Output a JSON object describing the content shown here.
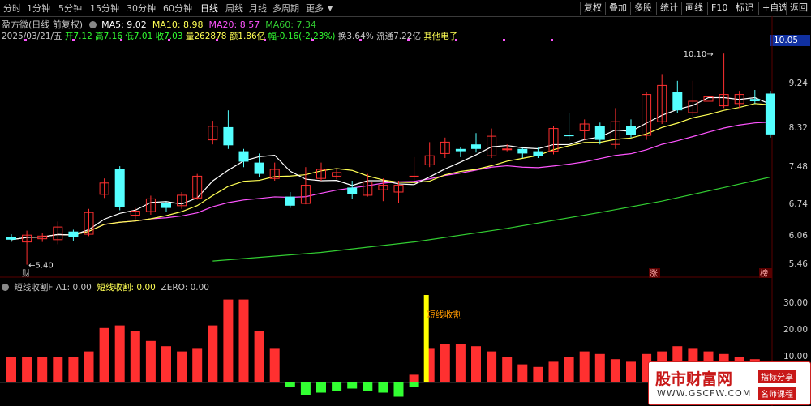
{
  "toolbar": {
    "periods": [
      "分时",
      "1分钟",
      "5分钟",
      "15分钟",
      "30分钟",
      "60分钟",
      "日线",
      "周线",
      "月线",
      "多周期",
      "更多"
    ],
    "active_period": "日线",
    "right_buttons": [
      "复权",
      "叠加",
      "多股",
      "统计",
      "画线",
      "F10",
      "标记",
      "+自选",
      "返回"
    ]
  },
  "header": {
    "stock_title": "盈方微(日线 前复权)",
    "ma_labels": {
      "ma5": "MA5: 9.02",
      "ma10": "MA10: 8.98",
      "ma20": "MA20: 8.57",
      "ma60": "MA60: 7.34"
    },
    "date": "2025/03/21/五",
    "open": "开7.12",
    "high": "高7.16",
    "low": "低7.01",
    "close": "收7.03",
    "volume": "量262878",
    "amount": "额1.86亿",
    "change": "幅-0.16(-2.23%)",
    "turnover": "换3.64%",
    "float": "流通7.22亿",
    "sector": "其他电子"
  },
  "indicator": {
    "name": "短线收割F",
    "a1": "A1: 0.00",
    "main": "短线收割: 0.00",
    "zero": "ZERO: 0.00",
    "signal_label": "短线收割"
  },
  "price_axis": [
    "9.24",
    "8.32",
    "7.48",
    "6.74",
    "6.06",
    "5.46"
  ],
  "current_price_box": "10.05",
  "indicator_axis": [
    "30.00",
    "20.00",
    "10.00"
  ],
  "annotations": {
    "high_label": "10.10",
    "low_label": "5.40",
    "marker_cai": "财",
    "marker_zhang": "涨",
    "marker_bang": "榜"
  },
  "watermark": {
    "site": "股市财富网",
    "url": "WWW.GSCFW.COM",
    "tag1": "指标分享",
    "tag2": "名师课程"
  },
  "colors": {
    "up": "#ff3030",
    "down": "#54ffff",
    "ma5": "#ffffff",
    "ma10": "#ffff54",
    "ma20": "#ff54ff",
    "ma60": "#32cd32",
    "signal": "#ffff00",
    "neg_bar": "#32ff32"
  },
  "chart_data": {
    "type": "candlestick",
    "ylim": [
      5.3,
      10.3
    ],
    "candles": [
      {
        "o": 6.06,
        "c": 6.0,
        "h": 6.12,
        "l": 5.95
      },
      {
        "o": 5.95,
        "c": 6.1,
        "h": 6.2,
        "l": 5.45
      },
      {
        "o": 6.02,
        "c": 6.08,
        "h": 6.15,
        "l": 5.95
      },
      {
        "o": 6.0,
        "c": 6.28,
        "h": 6.4,
        "l": 5.9
      },
      {
        "o": 6.18,
        "c": 6.05,
        "h": 6.22,
        "l": 5.98
      },
      {
        "o": 6.12,
        "c": 6.6,
        "h": 6.68,
        "l": 6.08
      },
      {
        "o": 7.0,
        "c": 7.25,
        "h": 7.35,
        "l": 6.92
      },
      {
        "o": 7.55,
        "c": 6.72,
        "h": 7.62,
        "l": 6.65
      },
      {
        "o": 6.54,
        "c": 6.63,
        "h": 6.7,
        "l": 6.45
      },
      {
        "o": 6.62,
        "c": 6.9,
        "h": 6.97,
        "l": 6.55
      },
      {
        "o": 6.8,
        "c": 6.7,
        "h": 6.83,
        "l": 6.62
      },
      {
        "o": 6.75,
        "c": 6.98,
        "h": 7.05,
        "l": 6.68
      },
      {
        "o": 6.92,
        "c": 7.4,
        "h": 7.45,
        "l": 6.88
      },
      {
        "o": 8.2,
        "c": 8.5,
        "h": 8.62,
        "l": 8.1
      },
      {
        "o": 8.48,
        "c": 8.08,
        "h": 8.85,
        "l": 8.0
      },
      {
        "o": 7.95,
        "c": 7.72,
        "h": 8.0,
        "l": 7.6
      },
      {
        "o": 7.7,
        "c": 7.45,
        "h": 7.9,
        "l": 7.38
      },
      {
        "o": 7.35,
        "c": 7.55,
        "h": 7.7,
        "l": 7.3
      },
      {
        "o": 6.95,
        "c": 6.75,
        "h": 7.05,
        "l": 6.7
      },
      {
        "o": 6.8,
        "c": 7.2,
        "h": 7.6,
        "l": 6.78
      },
      {
        "o": 7.35,
        "c": 7.55,
        "h": 7.7,
        "l": 7.3
      },
      {
        "o": 7.4,
        "c": 7.48,
        "h": 7.55,
        "l": 7.33
      },
      {
        "o": 7.15,
        "c": 7.0,
        "h": 7.3,
        "l": 6.9
      },
      {
        "o": 6.98,
        "c": 7.27,
        "h": 7.45,
        "l": 6.95
      },
      {
        "o": 7.1,
        "c": 7.2,
        "h": 7.35,
        "l": 6.85
      },
      {
        "o": 7.05,
        "c": 7.2,
        "h": 7.3,
        "l": 6.8
      },
      {
        "o": 7.4,
        "c": 7.4,
        "h": 7.82,
        "l": 7.3
      },
      {
        "o": 7.65,
        "c": 7.85,
        "h": 8.15,
        "l": 7.6
      },
      {
        "o": 7.9,
        "c": 8.15,
        "h": 8.25,
        "l": 7.8
      },
      {
        "o": 8.0,
        "c": 7.95,
        "h": 8.05,
        "l": 7.82
      },
      {
        "o": 8.1,
        "c": 8.0,
        "h": 8.35,
        "l": 7.92
      },
      {
        "o": 7.85,
        "c": 8.28,
        "h": 8.45,
        "l": 7.8
      },
      {
        "o": 8.0,
        "c": 8.0,
        "h": 8.1,
        "l": 7.95
      },
      {
        "o": 8.0,
        "c": 7.9,
        "h": 8.02,
        "l": 7.8
      },
      {
        "o": 7.95,
        "c": 7.85,
        "h": 8.03,
        "l": 7.8
      },
      {
        "o": 7.95,
        "c": 8.45,
        "h": 8.5,
        "l": 7.88
      },
      {
        "o": 8.3,
        "c": 8.28,
        "h": 8.8,
        "l": 8.2
      },
      {
        "o": 8.4,
        "c": 8.55,
        "h": 8.65,
        "l": 8.2
      },
      {
        "o": 8.5,
        "c": 8.2,
        "h": 8.58,
        "l": 8.1
      },
      {
        "o": 8.1,
        "c": 8.6,
        "h": 8.9,
        "l": 8.0
      },
      {
        "o": 8.5,
        "c": 8.3,
        "h": 8.65,
        "l": 8.25
      },
      {
        "o": 8.3,
        "c": 9.2,
        "h": 9.25,
        "l": 8.2
      },
      {
        "o": 8.6,
        "c": 9.4,
        "h": 9.65,
        "l": 8.55
      },
      {
        "o": 9.25,
        "c": 8.85,
        "h": 9.5,
        "l": 8.8
      },
      {
        "o": 8.8,
        "c": 9.05,
        "h": 9.5,
        "l": 8.7
      },
      {
        "o": 9.05,
        "c": 9.15,
        "h": 9.1,
        "l": 9.1
      },
      {
        "o": 8.95,
        "c": 9.2,
        "h": 10.1,
        "l": 8.9
      },
      {
        "o": 9.0,
        "c": 9.2,
        "h": 9.28,
        "l": 8.9
      },
      {
        "o": 9.1,
        "c": 9.05,
        "h": 9.3,
        "l": 9.0
      },
      {
        "o": 9.22,
        "c": 8.32,
        "h": 9.28,
        "l": 8.25
      }
    ],
    "ma60": [
      {
        "i": 13,
        "v": 5.53
      },
      {
        "i": 20,
        "v": 5.72
      },
      {
        "i": 26,
        "v": 5.95
      },
      {
        "i": 32,
        "v": 6.25
      },
      {
        "i": 38,
        "v": 6.6
      },
      {
        "i": 42,
        "v": 6.85
      },
      {
        "i": 46,
        "v": 7.15
      },
      {
        "i": 49,
        "v": 7.38
      }
    ],
    "indicator_bars": [
      10,
      10,
      10,
      10,
      10,
      12,
      21,
      22,
      20,
      16,
      14,
      12,
      13,
      22,
      32,
      32,
      20,
      13,
      0,
      0,
      0,
      0,
      0,
      0,
      0,
      0,
      3,
      13,
      15,
      15,
      14,
      12,
      10,
      7,
      6,
      8,
      10,
      12,
      11,
      9,
      8,
      11,
      12,
      14,
      13,
      12,
      11,
      10,
      9,
      7
    ],
    "neg_bars": [
      {
        "i": 18,
        "v": 2
      },
      {
        "i": 19,
        "v": 6
      },
      {
        "i": 20,
        "v": 5
      },
      {
        "i": 21,
        "v": 4
      },
      {
        "i": 22,
        "v": 3
      },
      {
        "i": 23,
        "v": 4
      },
      {
        "i": 24,
        "v": 5
      },
      {
        "i": 25,
        "v": 7
      },
      {
        "i": 26,
        "v": 2
      }
    ],
    "signal_index": 27,
    "indicator_ylim": [
      0,
      35
    ]
  }
}
